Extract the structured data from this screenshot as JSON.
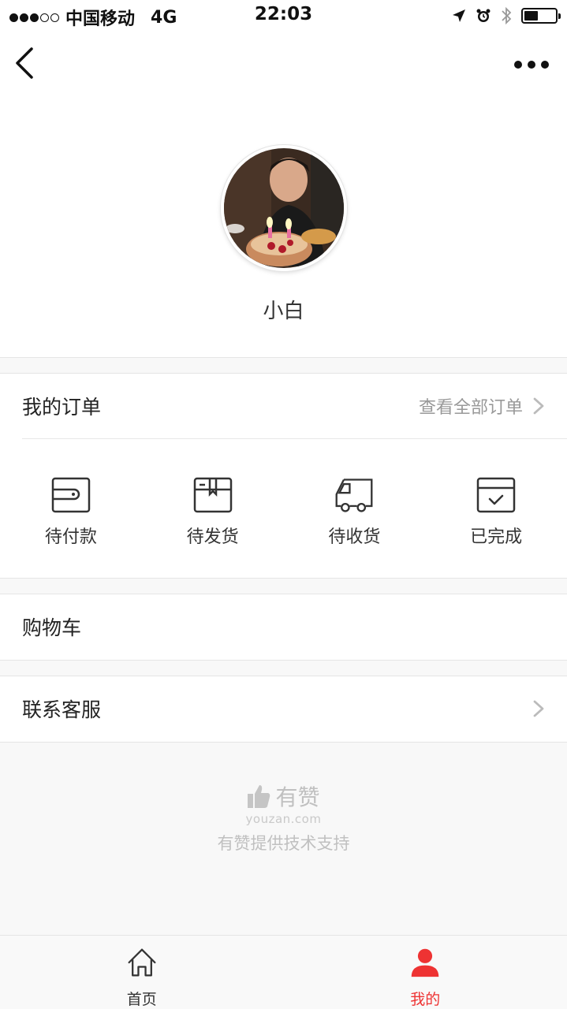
{
  "status_bar": {
    "signal": "●●●○○",
    "carrier": "中国移动",
    "network": "4G",
    "time": "22:03",
    "icons": [
      "location-arrow-icon",
      "alarm-icon",
      "bluetooth-icon",
      "battery-icon"
    ],
    "battery_level": 0.45
  },
  "nav": {
    "back_icon": "chevron-left-icon",
    "more_icon": "more-dots-icon"
  },
  "profile": {
    "avatar_desc": "avatar",
    "name": "小白"
  },
  "orders": {
    "title": "我的订单",
    "view_all": "查看全部订单",
    "items": [
      {
        "label": "待付款",
        "icon": "wallet-icon"
      },
      {
        "label": "待发货",
        "icon": "package-icon"
      },
      {
        "label": "待收货",
        "icon": "truck-icon"
      },
      {
        "label": "已完成",
        "icon": "calendar-check-icon"
      }
    ]
  },
  "cart": {
    "title": "购物车"
  },
  "service": {
    "title": "联系客服"
  },
  "footer": {
    "brand": "有赞",
    "url": "youzan.com",
    "support": "有赞提供技术支持"
  },
  "tabs": [
    {
      "label": "首页",
      "icon": "home-icon",
      "active": false
    },
    {
      "label": "我的",
      "icon": "user-icon",
      "active": true
    }
  ],
  "colors": {
    "accent": "#ee3333",
    "background": "#f8f8f8"
  }
}
